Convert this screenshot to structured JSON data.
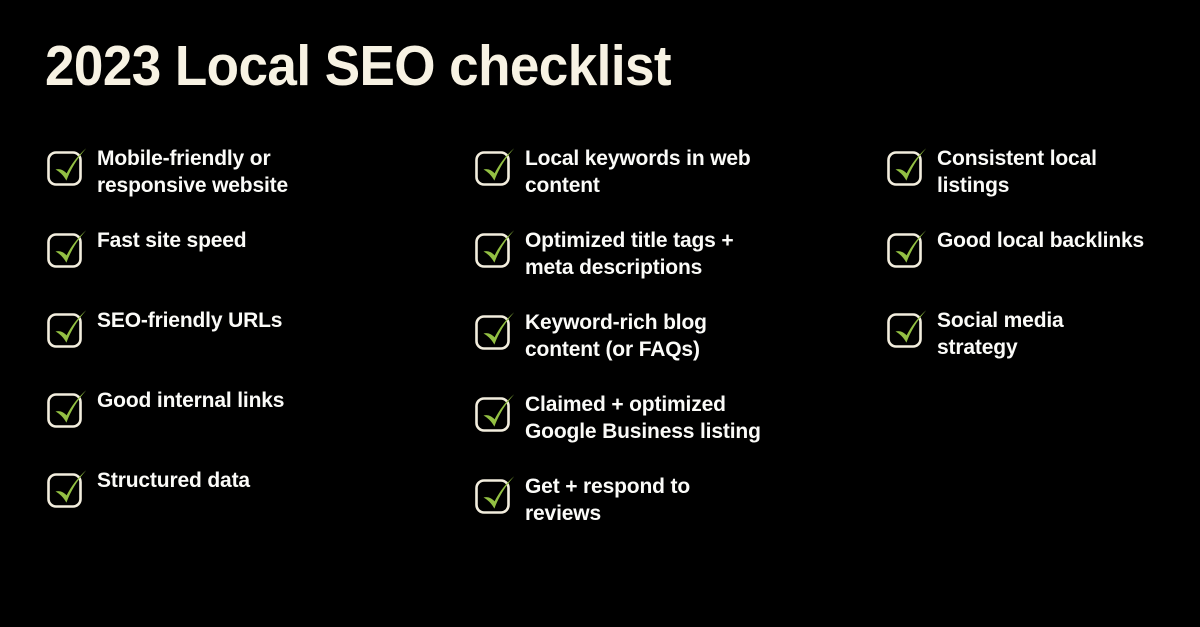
{
  "theme": {
    "background": "#000000",
    "title_color": "#F7F2E3",
    "text_color": "#FBFBF8",
    "check_color": "#93C043",
    "box_stroke_color": "#F3EEDE"
  },
  "header": {
    "title": "2023 Local SEO checklist"
  },
  "checklist": {
    "columns": [
      {
        "id": "column-1",
        "items": [
          {
            "label": "Mobile-friendly or\nresponsive website",
            "icon": "checked-checkbox-icon",
            "checked": true,
            "lines": 2
          },
          {
            "label": "Fast site speed",
            "icon": "checked-checkbox-icon",
            "checked": true,
            "lines": 1
          },
          {
            "label": "SEO-friendly URLs",
            "icon": "checked-checkbox-icon",
            "checked": true,
            "lines": 1
          },
          {
            "label": "Good internal links",
            "icon": "checked-checkbox-icon",
            "checked": true,
            "lines": 1
          },
          {
            "label": "Structured data",
            "icon": "checked-checkbox-icon",
            "checked": true,
            "lines": 1
          }
        ]
      },
      {
        "id": "column-2",
        "items": [
          {
            "label": "Local keywords in web\ncontent",
            "icon": "checked-checkbox-icon",
            "checked": true,
            "lines": 2
          },
          {
            "label": "Optimized title tags +\nmeta descriptions",
            "icon": "checked-checkbox-icon",
            "checked": true,
            "lines": 2
          },
          {
            "label": "Keyword-rich blog\ncontent (or FAQs)",
            "icon": "checked-checkbox-icon",
            "checked": true,
            "lines": 2
          },
          {
            "label": "Claimed + optimized\nGoogle Business listing",
            "icon": "checked-checkbox-icon",
            "checked": true,
            "lines": 2
          },
          {
            "label": "Get + respond to\nreviews",
            "icon": "checked-checkbox-icon",
            "checked": true,
            "lines": 2
          }
        ]
      },
      {
        "id": "column-3",
        "items": [
          {
            "label": "Consistent local\nlistings",
            "icon": "checked-checkbox-icon",
            "checked": true,
            "lines": 2
          },
          {
            "label": "Good local backlinks",
            "icon": "checked-checkbox-icon",
            "checked": true,
            "lines": 1
          },
          {
            "label": "Social media\nstrategy",
            "icon": "checked-checkbox-icon",
            "checked": true,
            "lines": 2
          }
        ]
      }
    ]
  }
}
